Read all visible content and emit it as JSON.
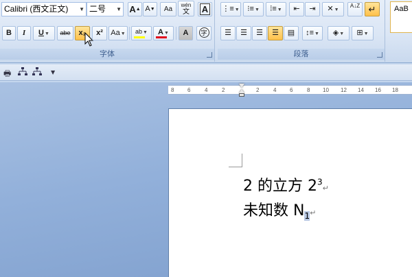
{
  "font_group": {
    "label": "字体",
    "font_name": "Calibri (西文正文)",
    "font_size": "二号",
    "grow_font": "A",
    "shrink_font": "A",
    "clear_format": "Aa",
    "phonetic": "wén",
    "char_border": "A",
    "bold": "B",
    "italic": "I",
    "underline": "U",
    "strike": "abe",
    "subscript": "x₂",
    "superscript": "x²",
    "change_case": "Aa",
    "highlight": "ab",
    "font_color": "A",
    "char_shade": "A",
    "enclose": "字"
  },
  "para_group": {
    "label": "段落",
    "sort": "A↓Z"
  },
  "styles_group": {
    "preview": "AaB"
  },
  "ruler": {
    "ticks": [
      "8",
      "6",
      "4",
      "2",
      "2",
      "4",
      "6",
      "8",
      "10",
      "12",
      "14",
      "16",
      "18"
    ]
  },
  "document": {
    "line1_text": "2 的立方 2",
    "line1_sup": "3",
    "line2_text": "未知数 N",
    "line2_sub": "1",
    "para_mark": "↵"
  },
  "colors": {
    "font_color_bar": "#e0001a",
    "highlight_bar": "#ffff00",
    "active_button": "#ffc04a"
  }
}
